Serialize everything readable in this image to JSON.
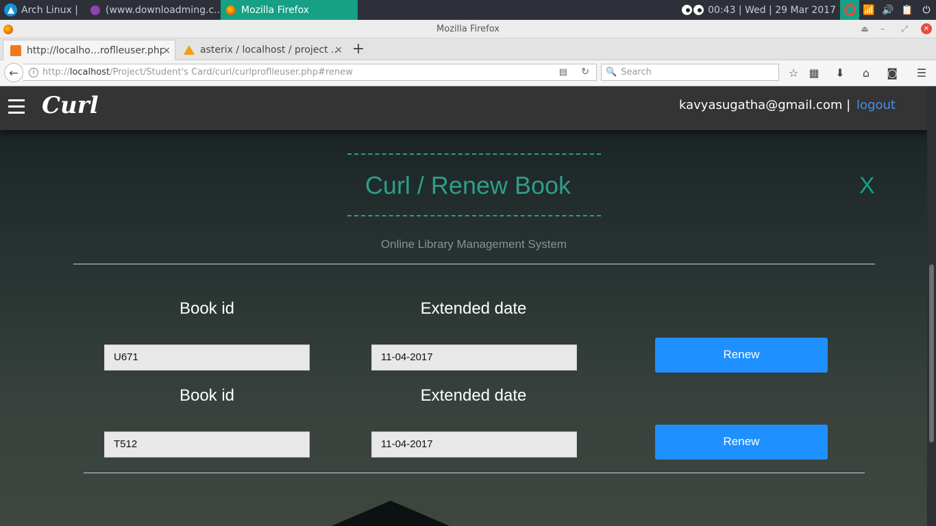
{
  "taskbar": {
    "os_label": "Arch Linux |",
    "tasks": [
      {
        "label": "(www.downloadming.c...",
        "icon": "app-icon",
        "color": "#8e44ad"
      },
      {
        "label": "Mozilla Firefox",
        "icon": "firefox-icon",
        "color": "#e66000"
      }
    ],
    "clock": "00:43  |  Wed  |  29 Mar 2017"
  },
  "window": {
    "title": "Mozilla Firefox"
  },
  "tabs": [
    {
      "label": "http://localho…roflleuser.php",
      "close": "×"
    },
    {
      "label": "asterix / localhost / project ...",
      "close": "×"
    }
  ],
  "newtab_label": "+",
  "nav": {
    "url_prefix": "http://",
    "url_host": "localhost",
    "url_path": "/Project/Student's Card/curl/curlproflleuser.php#renew",
    "search_placeholder": "Search"
  },
  "site": {
    "brand": "Curl",
    "user_email": "kavyasugatha@gmail.com |",
    "logout": "logout"
  },
  "modal": {
    "title": "Curl / Renew Book",
    "close": "X",
    "subtitle": "Online Library Management System",
    "rows": [
      {
        "book_label": "Book id",
        "date_label": "Extended date",
        "book_id": "U671",
        "date": "11-04-2017",
        "button": "Renew"
      },
      {
        "book_label": "Book id",
        "date_label": "Extended date",
        "book_id": "T512",
        "date": "11-04-2017",
        "button": "Renew"
      }
    ]
  },
  "colors": {
    "accent": "#2e9e89",
    "button": "#1e90ff",
    "taskbar_active": "#16a085"
  }
}
